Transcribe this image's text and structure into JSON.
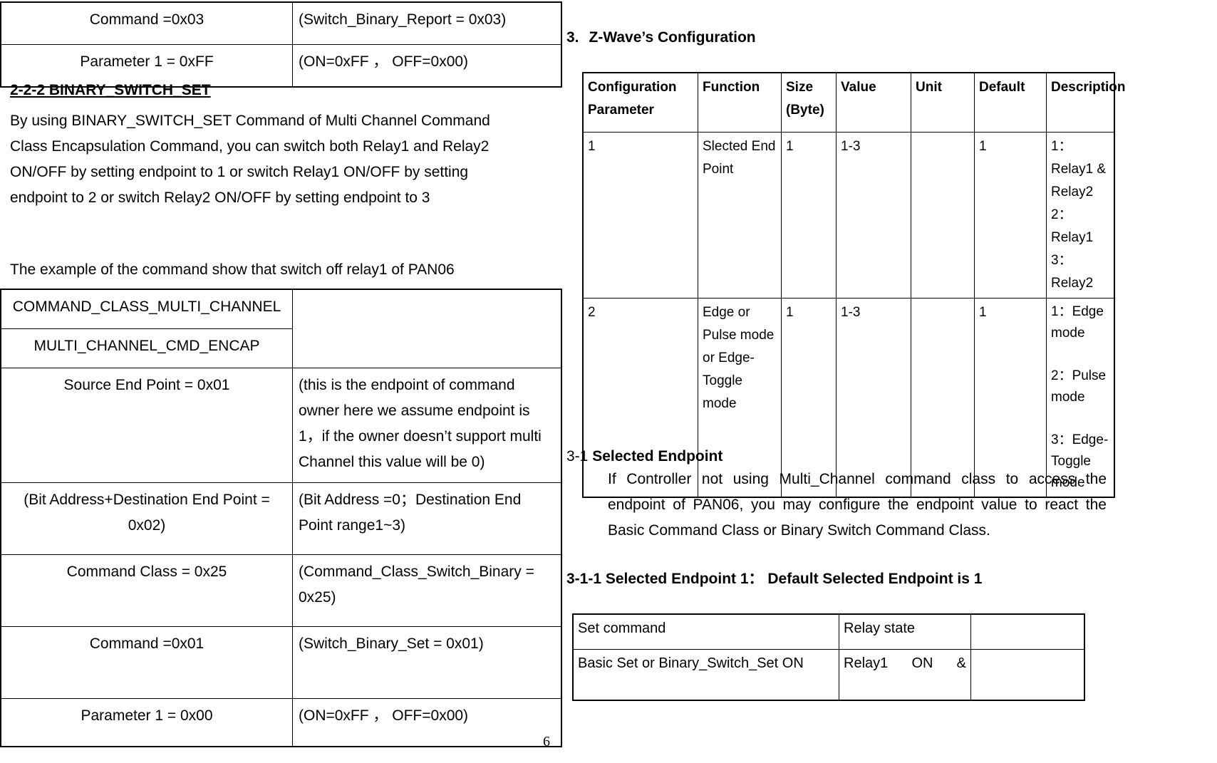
{
  "document": {
    "page_number": "6"
  },
  "left_column": {
    "top_table": {
      "rows": [
        {
          "left": "Command =0x03",
          "right": "(Switch_Binary_Report = 0x03)"
        },
        {
          "left": "Parameter 1 = 0xFF",
          "right": "(ON=0xFF ，  OFF=0x00)"
        }
      ]
    },
    "section_heading": "2-2-2 BINARY_SWITCH_SET",
    "body_paragraph": "By using BINARY_SWITCH_SET Command of Multi Channel Command Class Encapsulation Command, you can switch both Relay1 and Relay2 ON/OFF by setting endpoint to 1 or switch Relay1 ON/OFF by setting endpoint to 2 or switch Relay2 ON/OFF by setting endpoint to 3",
    "example_caption": "The example of the command show that switch off relay1 of PAN06",
    "example_table": {
      "rows": [
        {
          "left": "COMMAND_CLASS_MULTI_CHANNEL",
          "right": ""
        },
        {
          "left": "MULTI_CHANNEL_CMD_ENCAP",
          "right": ""
        },
        {
          "left": "Source End Point = 0x01",
          "right": "(this is the endpoint of command owner here we assume endpoint is 1，if the owner doesn’t support multi Channel this value will be 0)"
        },
        {
          "left": "(Bit Address+Destination End Point = 0x02)",
          "right": "(Bit Address =0；Destination End Point range1~3)"
        },
        {
          "left": "Command Class = 0x25",
          "right": "(Command_Class_Switch_Binary = 0x25)"
        },
        {
          "left": "Command =0x01",
          "right": "(Switch_Binary_Set = 0x01)"
        },
        {
          "left": "Parameter 1 = 0x00",
          "right": "(ON=0xFF ，  OFF=0x00)"
        }
      ]
    }
  },
  "right_column": {
    "section_number": "3.",
    "section_title": "Z-Wave’s Configuration",
    "config_table": {
      "headers": [
        "Configuration Parameter",
        "Function",
        "Size (Byte)",
        "Value",
        "Unit",
        "Default",
        "Description"
      ],
      "rows": [
        {
          "parameter": "1",
          "function": "Slected End Point",
          "size": "1",
          "value": "1-3",
          "unit": "",
          "default": "1",
          "description": "1：Relay1 & Relay2\n2：Relay1\n3：Relay2"
        },
        {
          "parameter": "2",
          "function": "Edge or Pulse mode or Edge-Toggle mode",
          "size": "1",
          "value": "1-3",
          "unit": "",
          "default": "1",
          "description": "1：Edge mode\n\n2：Pulse mode\n\n3：Edge-Toggle mode"
        }
      ]
    },
    "subsection_3_1": {
      "number": "3-1 ",
      "title": "Selected Endpoint",
      "body": "If Controller not using Multi_Channel command class to access the endpoint of PAN06, you may configure the endpoint value to react the Basic Command Class or Binary Switch Command Class."
    },
    "subsection_3_1_1": {
      "title": "3-1-1 Selected Endpoint 1：  Default Selected Endpoint is 1"
    },
    "relay_table": {
      "rows": [
        {
          "command": "Set command",
          "state": "Relay state",
          "extra": "",
          "justify": false
        },
        {
          "command": "Basic Set or Binary_Switch_Set ON",
          "state": "Relay1    ON    &",
          "extra": "",
          "justify": true
        }
      ]
    }
  }
}
